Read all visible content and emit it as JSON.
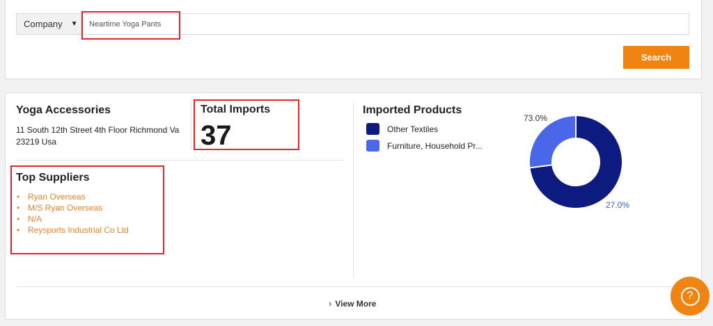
{
  "search": {
    "type_label": "Company",
    "query": "Neartime Yoga Pants",
    "button_label": "Search"
  },
  "company": {
    "name": "Yoga Accessories",
    "address": "11 South 12th Street 4th Floor Richmond Va 23219 Usa"
  },
  "imports": {
    "label": "Total Imports",
    "value": "37"
  },
  "suppliers": {
    "title": "Top Suppliers",
    "items": [
      {
        "label": "Ryan Overseas"
      },
      {
        "label": "M/S Ryan Overseas"
      },
      {
        "label": "N/A"
      },
      {
        "label": "Reysports Industrial Co Ltd"
      }
    ]
  },
  "products": {
    "title": "Imported Products",
    "legend": [
      {
        "label": "Other Textiles",
        "color": "#0d1a80"
      },
      {
        "label": "Furniture, Household Pr...",
        "color": "#4a67ea"
      }
    ]
  },
  "chart_data": {
    "type": "pie",
    "donut": true,
    "categories": [
      "Other Textiles",
      "Furniture, Household Pr..."
    ],
    "values": [
      73.0,
      27.0
    ],
    "data_labels": [
      "73.0%",
      "27.0%"
    ],
    "colors": [
      "#0d1a80",
      "#4a67ea"
    ]
  },
  "footer": {
    "view_more_label": "View More"
  },
  "help": {
    "icon": "question-circle-icon",
    "glyph": "?"
  },
  "highlight_color": "#e2232a",
  "accent_color": "#f08412"
}
